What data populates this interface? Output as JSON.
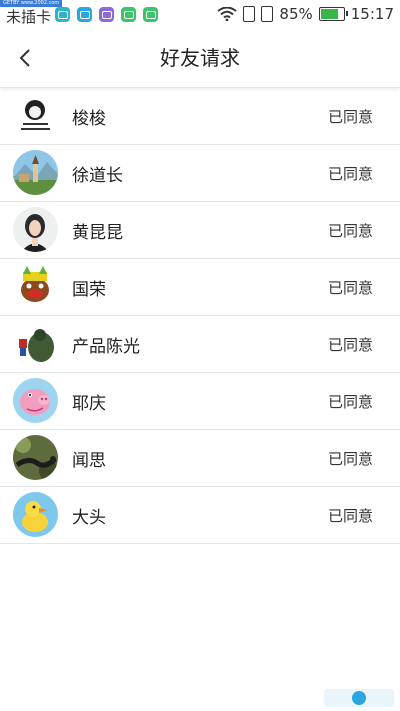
{
  "statusbar": {
    "carrier": "未插卡",
    "battery_percent": "85%",
    "time": "15:17",
    "watermark": "GETBY www.2002.com"
  },
  "header": {
    "title": "好友请求"
  },
  "requests": [
    {
      "name": "梭梭",
      "status": "已同意"
    },
    {
      "name": "徐道长",
      "status": "已同意"
    },
    {
      "name": "黄昆昆",
      "status": "已同意"
    },
    {
      "name": "国荣",
      "status": "已同意"
    },
    {
      "name": "产品陈光",
      "status": "已同意"
    },
    {
      "name": "耶庆",
      "status": "已同意"
    },
    {
      "name": "闻思",
      "status": "已同意"
    },
    {
      "name": "大头",
      "status": "已同意"
    }
  ]
}
